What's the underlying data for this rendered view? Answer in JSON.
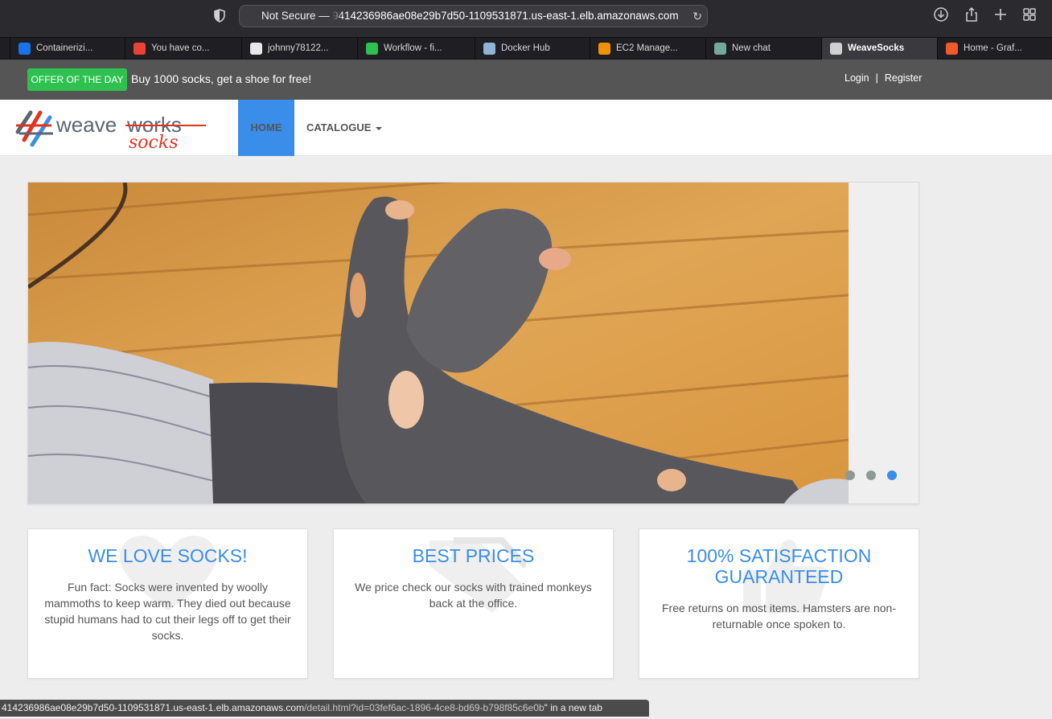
{
  "browser": {
    "security_label": "Not Secure —",
    "url_host": "9414236986ae08e29b7d50-1109531871.us-east-1.elb.amazonaws.com",
    "reload_icon": "reload-icon",
    "tabs": [
      {
        "label": "Containerizi...",
        "color": "#1a73e8",
        "active": false
      },
      {
        "label": "You have co...",
        "color": "#ea4335",
        "active": false
      },
      {
        "label": "johnny78122...",
        "color": "#e8e8e8",
        "active": false
      },
      {
        "label": "Workflow - fi...",
        "color": "#2ec14f",
        "active": false
      },
      {
        "label": "Docker Hub",
        "color": "#8fb3d9",
        "active": false
      },
      {
        "label": "EC2 Manage...",
        "color": "#f29100",
        "active": false
      },
      {
        "label": "New chat",
        "color": "#74aa9c",
        "active": false
      },
      {
        "label": "WeaveSocks",
        "color": "#d0d0d0",
        "active": true
      },
      {
        "label": "Home - Graf...",
        "color": "#f05a28",
        "active": false
      }
    ]
  },
  "offer": {
    "badge": "OFFER OF THE DAY",
    "text": "Buy 1000 socks, get a shoe for free!"
  },
  "account": {
    "login": "Login",
    "separator": "|",
    "register": "Register"
  },
  "nav": {
    "logo_word1": "weave",
    "logo_word2": "works",
    "logo_word3": "socks",
    "home": "HOME",
    "catalogue": "CATALOGUE"
  },
  "carousel": {
    "slide_count": 3,
    "active_index": 2
  },
  "features": [
    {
      "title": "WE LOVE SOCKS!",
      "text": "Fun fact: Socks were invented by woolly mammoths to keep warm. They died out because stupid humans had to cut their legs off to get their socks.",
      "icon": "heart-icon"
    },
    {
      "title": "BEST PRICES",
      "text": "We price check our socks with trained monkeys back at the office.",
      "icon": "tag-icon"
    },
    {
      "title": "100% SATISFACTION GUARANTEED",
      "text": "Free returns on most items. Hamsters are non-returnable once spoken to.",
      "icon": "thumbs-up-icon"
    }
  ],
  "status_bar": {
    "host": "414236986ae08e29b7d50-1109531871.us-east-1.elb.amazonaws.com",
    "path": "/detail.html?id=03fef6ac-1896-4ce8-bd69-b798f85c6e0b",
    "suffix": "\" in a new tab"
  }
}
